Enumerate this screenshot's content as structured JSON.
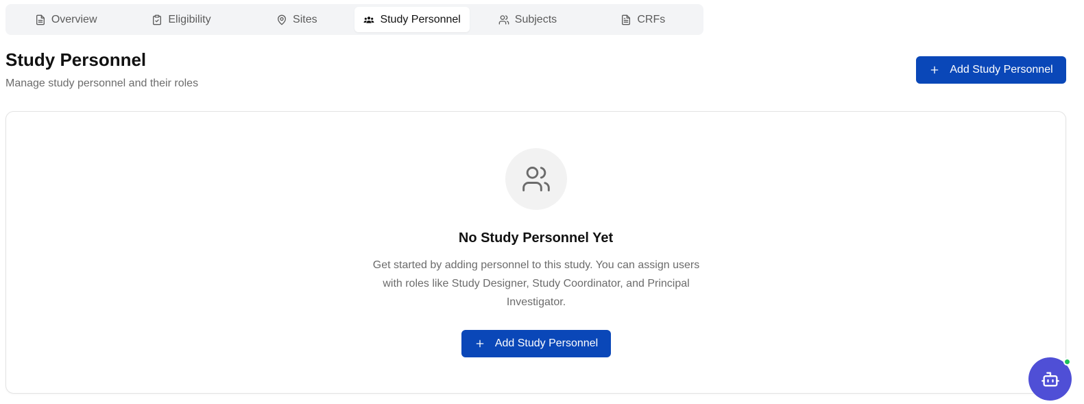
{
  "tabs": [
    {
      "label": "Overview",
      "icon": "file-text-icon"
    },
    {
      "label": "Eligibility",
      "icon": "clipboard-check-icon"
    },
    {
      "label": "Sites",
      "icon": "map-pin-icon"
    },
    {
      "label": "Study Personnel",
      "icon": "users-filled-icon",
      "active": true
    },
    {
      "label": "Subjects",
      "icon": "users-icon"
    },
    {
      "label": "CRFs",
      "icon": "file-text-icon"
    }
  ],
  "header": {
    "title": "Study Personnel",
    "subtitle": "Manage study personnel and their roles",
    "add_button_label": "Add Study Personnel"
  },
  "empty_state": {
    "icon": "users-icon",
    "title": "No Study Personnel Yet",
    "description": "Get started by adding personnel to this study. You can assign users with roles like Study Designer, Study Coordinator, and Principal Investigator.",
    "add_button_label": "Add Study Personnel"
  },
  "assistant": {
    "icon": "bot-icon",
    "status": "online"
  },
  "colors": {
    "primary": "#0a47b8",
    "assistant": "#4f4fd6",
    "online": "#1fc35a"
  }
}
